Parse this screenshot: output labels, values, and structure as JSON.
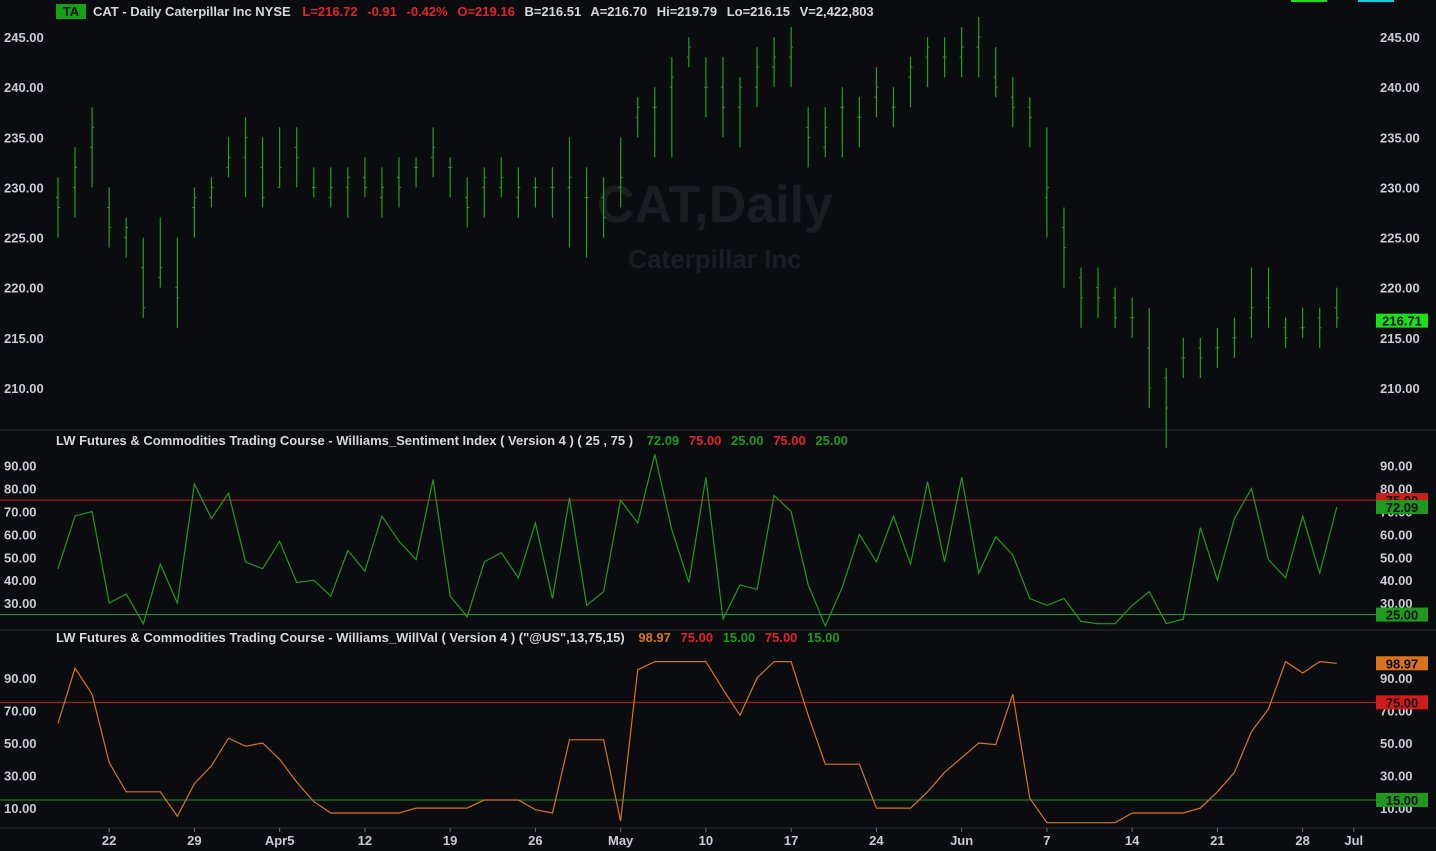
{
  "header": {
    "badge": "TA",
    "symbol_line": "CAT - Daily  Caterpillar Inc  NYSE",
    "last": "L=216.72",
    "change": "-0.91",
    "change_pct": "-0.42%",
    "open": "O=219.16",
    "bid": "B=216.51",
    "ask": "A=216.70",
    "high": "Hi=219.79",
    "low": "Lo=216.15",
    "volume": "V=2,422,803"
  },
  "watermark": {
    "title": "CAT,Daily",
    "subtitle": "Caterpillar Inc"
  },
  "colors": {
    "background": "#0b0c0f",
    "price_bar": "#1fa01f",
    "sentiment_line": "#1f9a1f",
    "willval_line": "#d9741c",
    "upper_band": "#d11b1b",
    "lower_band": "#1f9a1f",
    "last_price_flag": "#19e019",
    "willval_flag": "#d9741c"
  },
  "x_axis": {
    "tick_labels": [
      "22",
      "29",
      "Apr5",
      "12",
      "19",
      "26",
      "May",
      "10",
      "17",
      "24",
      "Jun",
      "7",
      "14",
      "21",
      "28",
      "Jul"
    ],
    "tick_positions": [
      3,
      8,
      13,
      18,
      23,
      28,
      33,
      38,
      43,
      48,
      53,
      58,
      63,
      68,
      73,
      76
    ]
  },
  "chart_data": [
    {
      "type": "ohlc",
      "name": "price",
      "ylim": [
        206,
        248
      ],
      "yticks": [
        210,
        215,
        220,
        225,
        230,
        235,
        240,
        245
      ],
      "ytick_labels": [
        "210.00",
        "215.00",
        "220.00",
        "225.00",
        "230.00",
        "235.00",
        "240.00",
        "245.00"
      ],
      "last_value": 216.71,
      "last_label": "216.71",
      "bars": [
        [
          229,
          231,
          225,
          228
        ],
        [
          230,
          234,
          227,
          232
        ],
        [
          234,
          238,
          230,
          236
        ],
        [
          228,
          230,
          224,
          226
        ],
        [
          225,
          227,
          223,
          226
        ],
        [
          222,
          225,
          217,
          218
        ],
        [
          221,
          227,
          220,
          222
        ],
        [
          220,
          225,
          216,
          219
        ],
        [
          228,
          230,
          225,
          229
        ],
        [
          229,
          231,
          228,
          230
        ],
        [
          232,
          235,
          231,
          233
        ],
        [
          233,
          237,
          229,
          235
        ],
        [
          232,
          235,
          228,
          229
        ],
        [
          230,
          236,
          230,
          232
        ],
        [
          234,
          236,
          230,
          233
        ],
        [
          230,
          232,
          229,
          230
        ],
        [
          229,
          232,
          228,
          230
        ],
        [
          230,
          232,
          227,
          231
        ],
        [
          231,
          233,
          229,
          230
        ],
        [
          229,
          232,
          227,
          230
        ],
        [
          231,
          233,
          228,
          230
        ],
        [
          232,
          233,
          230,
          232
        ],
        [
          233,
          236,
          231,
          234
        ],
        [
          232,
          233,
          229,
          232
        ],
        [
          229,
          231,
          226,
          228
        ],
        [
          230,
          232,
          227,
          231
        ],
        [
          230,
          233,
          229,
          231
        ],
        [
          229,
          232,
          227,
          230
        ],
        [
          230,
          231,
          228,
          230
        ],
        [
          230,
          232,
          227,
          230
        ],
        [
          230,
          235,
          224,
          231
        ],
        [
          229,
          232,
          223,
          229
        ],
        [
          229,
          231,
          225,
          227
        ],
        [
          230,
          235,
          228,
          231
        ],
        [
          237,
          239,
          235,
          238
        ],
        [
          238,
          240,
          233,
          238
        ],
        [
          240,
          243,
          233,
          241
        ],
        [
          243,
          245,
          242,
          244
        ],
        [
          240,
          243,
          237,
          240
        ],
        [
          240,
          243,
          235,
          238
        ],
        [
          238,
          241,
          234,
          240
        ],
        [
          240,
          244,
          238,
          242
        ],
        [
          242,
          245,
          240,
          243
        ],
        [
          243,
          246,
          240,
          244
        ],
        [
          236,
          238,
          232,
          235
        ],
        [
          234,
          238,
          233,
          236
        ],
        [
          238,
          240,
          233,
          238
        ],
        [
          237,
          239,
          234,
          237
        ],
        [
          239,
          242,
          237,
          240
        ],
        [
          238,
          240,
          236,
          238
        ],
        [
          241,
          243,
          238,
          242
        ],
        [
          243,
          245,
          240,
          244
        ],
        [
          243,
          245,
          241,
          243
        ],
        [
          243,
          246,
          241,
          244
        ],
        [
          244,
          247,
          241,
          245
        ],
        [
          241,
          244,
          239,
          240
        ],
        [
          239,
          241,
          236,
          238
        ],
        [
          238,
          239,
          234,
          237
        ],
        [
          229,
          236,
          225,
          230
        ],
        [
          226,
          228,
          220,
          224
        ],
        [
          221,
          222,
          216,
          219
        ],
        [
          220,
          222,
          217,
          219
        ],
        [
          219,
          220,
          216,
          217
        ],
        [
          217,
          219,
          215,
          217
        ],
        [
          214,
          218,
          208,
          210
        ],
        [
          211,
          212,
          204,
          208
        ],
        [
          213,
          215,
          211,
          213
        ],
        [
          214,
          215,
          211,
          213
        ],
        [
          214,
          216,
          212,
          214
        ],
        [
          215,
          217,
          213,
          215
        ],
        [
          217,
          222,
          215,
          218
        ],
        [
          219,
          222,
          216,
          218
        ],
        [
          216,
          217,
          214,
          215
        ],
        [
          216,
          218,
          215,
          216
        ],
        [
          217,
          218,
          214,
          216
        ],
        [
          218,
          220,
          216,
          217
        ]
      ]
    },
    {
      "type": "line",
      "name": "Williams_Sentiment Index",
      "title": "LW Futures & Commodities Trading Course - Williams_Sentiment Index ( Version 4 ) ( 25 , 75 )",
      "readouts": [
        "72.09",
        "75.00",
        "25.00",
        "75.00",
        "25.00"
      ],
      "ylim": [
        20,
        96
      ],
      "yticks": [
        30,
        40,
        50,
        60,
        70,
        80,
        90
      ],
      "ytick_labels": [
        "30.00",
        "40.00",
        "50.00",
        "60.00",
        "70.00",
        "80.00",
        "90.00"
      ],
      "upper_band": 75,
      "lower_band": 25,
      "last_label": "72.09",
      "upper_label": "75.00",
      "lower_label": "25.00",
      "values": [
        45,
        68,
        70,
        30,
        34,
        21,
        47,
        30,
        82,
        67,
        78,
        48,
        45,
        57,
        39,
        40,
        33,
        53,
        44,
        68,
        57,
        49,
        84,
        33,
        24,
        48,
        52,
        41,
        65,
        32,
        76,
        29,
        35,
        75,
        65,
        95,
        62,
        39,
        85,
        23,
        38,
        36,
        77,
        70,
        38,
        20,
        37,
        60,
        48,
        68,
        47,
        83,
        48,
        85,
        43,
        59,
        51,
        32,
        29,
        32,
        22,
        21,
        21,
        29,
        35,
        21,
        23,
        63,
        40,
        67,
        80,
        49,
        41,
        68,
        43,
        72
      ]
    },
    {
      "type": "line",
      "name": "Williams_WillVal",
      "title": "LW Futures & Commodities Trading Course - Williams_WillVal ( Version 4 ) (\"@US\",13,75,15)",
      "readouts": [
        "98.97",
        "75.00",
        "15.00",
        "75.00",
        "15.00"
      ],
      "ylim": [
        -1,
        109
      ],
      "yticks": [
        10,
        30,
        50,
        70,
        90
      ],
      "ytick_labels": [
        "10.00",
        "30.00",
        "50.00",
        "70.00",
        "90.00"
      ],
      "upper_band": 75,
      "lower_band": 15,
      "last_label": "98.97",
      "upper_label": "75.00",
      "lower_label": "15.00",
      "values": [
        62,
        96,
        80,
        38,
        20,
        20,
        20,
        5,
        25,
        36,
        53,
        48,
        50,
        40,
        26,
        14,
        7,
        7,
        7,
        7,
        7,
        10,
        10,
        10,
        10,
        15,
        15,
        15,
        9,
        7,
        52,
        52,
        52,
        2,
        95,
        100,
        100,
        100,
        100,
        83,
        67,
        90,
        100,
        100,
        67,
        37,
        37,
        37,
        10,
        10,
        10,
        20,
        32,
        41,
        50,
        49,
        80,
        16,
        1,
        1,
        1,
        1,
        1,
        7,
        7,
        7,
        7,
        10,
        20,
        32,
        57,
        71,
        100,
        93,
        100,
        99
      ]
    }
  ]
}
